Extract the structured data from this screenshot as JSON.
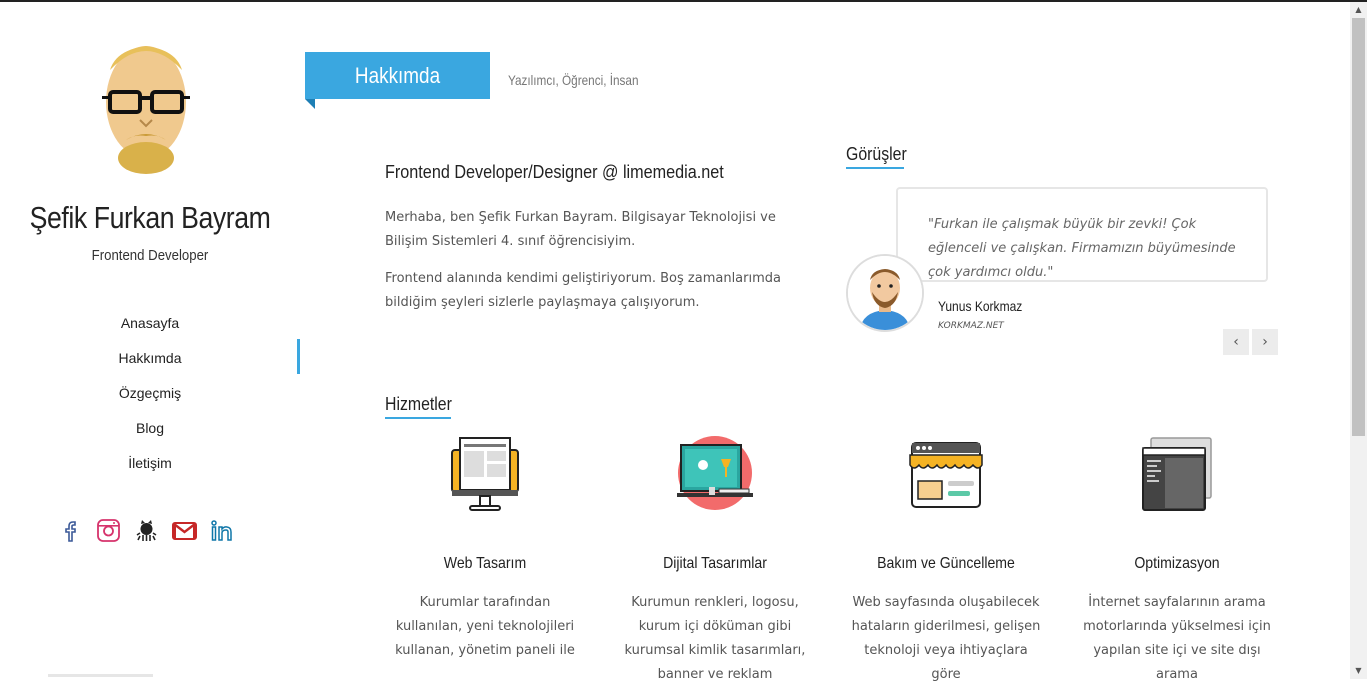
{
  "profile": {
    "name": "Şefik Furkan Bayram",
    "role": "Frontend Developer"
  },
  "nav": {
    "items": [
      {
        "label": "Anasayfa"
      },
      {
        "label": "Hakkımda"
      },
      {
        "label": "Özgeçmiş"
      },
      {
        "label": "Blog"
      },
      {
        "label": "İletişim"
      }
    ],
    "active_index": 1
  },
  "social": [
    "facebook-icon",
    "instagram-icon",
    "github-icon",
    "gmail-icon",
    "linkedin-icon"
  ],
  "section": {
    "title": "Hakkımda",
    "subtitle": "Yazılımcı, Öğrenci, İnsan"
  },
  "about": {
    "title": "Frontend Developer/Designer @ limemedia.net",
    "p1": "Merhaba, ben Şefik Furkan Bayram. Bilgisayar Teknolojisi ve Bilişim Sistemleri 4. sınıf öğrencisiyim.",
    "p2": "Frontend alanında kendimi geliştiriyorum. Boş zamanlarımda bildiğim şeyleri sizlerle paylaşmaya çalışıyorum."
  },
  "testimonials": {
    "heading": "Görüşler",
    "quote": "\"Furkan ile çalışmak büyük bir zevki! Çok eğlenceli ve çalışkan. Firmamızın büyümesinde çok yardımcı oldu.\"",
    "name": "Yunus Korkmaz",
    "site": "KORKMAZ.NET",
    "prev": "‹",
    "next": "›"
  },
  "services": {
    "heading": "Hizmetler",
    "items": [
      {
        "title": "Web Tasarım",
        "desc": "Kurumlar tarafından kullanılan, yeni teknolojileri kullanan, yönetim paneli ile"
      },
      {
        "title": "Dijital Tasarımlar",
        "desc": "Kurumun renkleri, logosu, kurum içi döküman gibi kurumsal kimlik tasarımları, banner ve reklam"
      },
      {
        "title": "Bakım ve Güncelleme",
        "desc": "Web sayfasında oluşabilecek hataların giderilmesi, gelişen teknoloji veya ihtiyaçlara göre"
      },
      {
        "title": "Optimizasyon",
        "desc": "İnternet sayfalarının arama motorlarında yükselmesi için yapılan site içi ve site dışı arama"
      }
    ]
  },
  "colors": {
    "accent": "#3aa7e0"
  }
}
